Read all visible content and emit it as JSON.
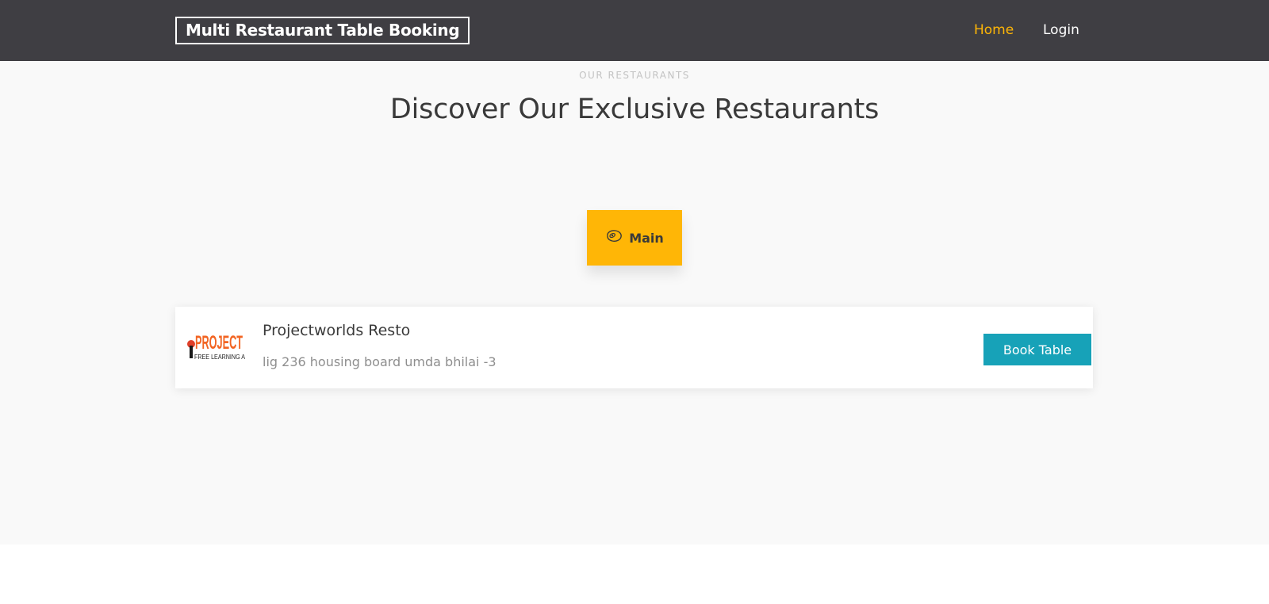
{
  "navbar": {
    "brand": "Multi Restaurant Table Booking",
    "links": [
      {
        "label": "Home",
        "active": true
      },
      {
        "label": "Login",
        "active": false
      }
    ]
  },
  "section": {
    "eyebrow": "OUR RESTAURANTS",
    "heading": "Discover Our Exclusive Restaurants"
  },
  "tabs": [
    {
      "label": "Main",
      "icon": "steak-icon",
      "active": true
    }
  ],
  "restaurants": [
    {
      "name": "Projectworlds Resto",
      "address": "lig 236 housing board umda bhilai -3",
      "logo_text": "PROJECT",
      "logo_subtext": "FREE LEARNING A",
      "button": "Book Table"
    }
  ],
  "colors": {
    "navbar_bg": "#3f3e43",
    "accent": "#ffb606",
    "button": "#17a2b8",
    "section_bg": "#f9f9f9"
  }
}
